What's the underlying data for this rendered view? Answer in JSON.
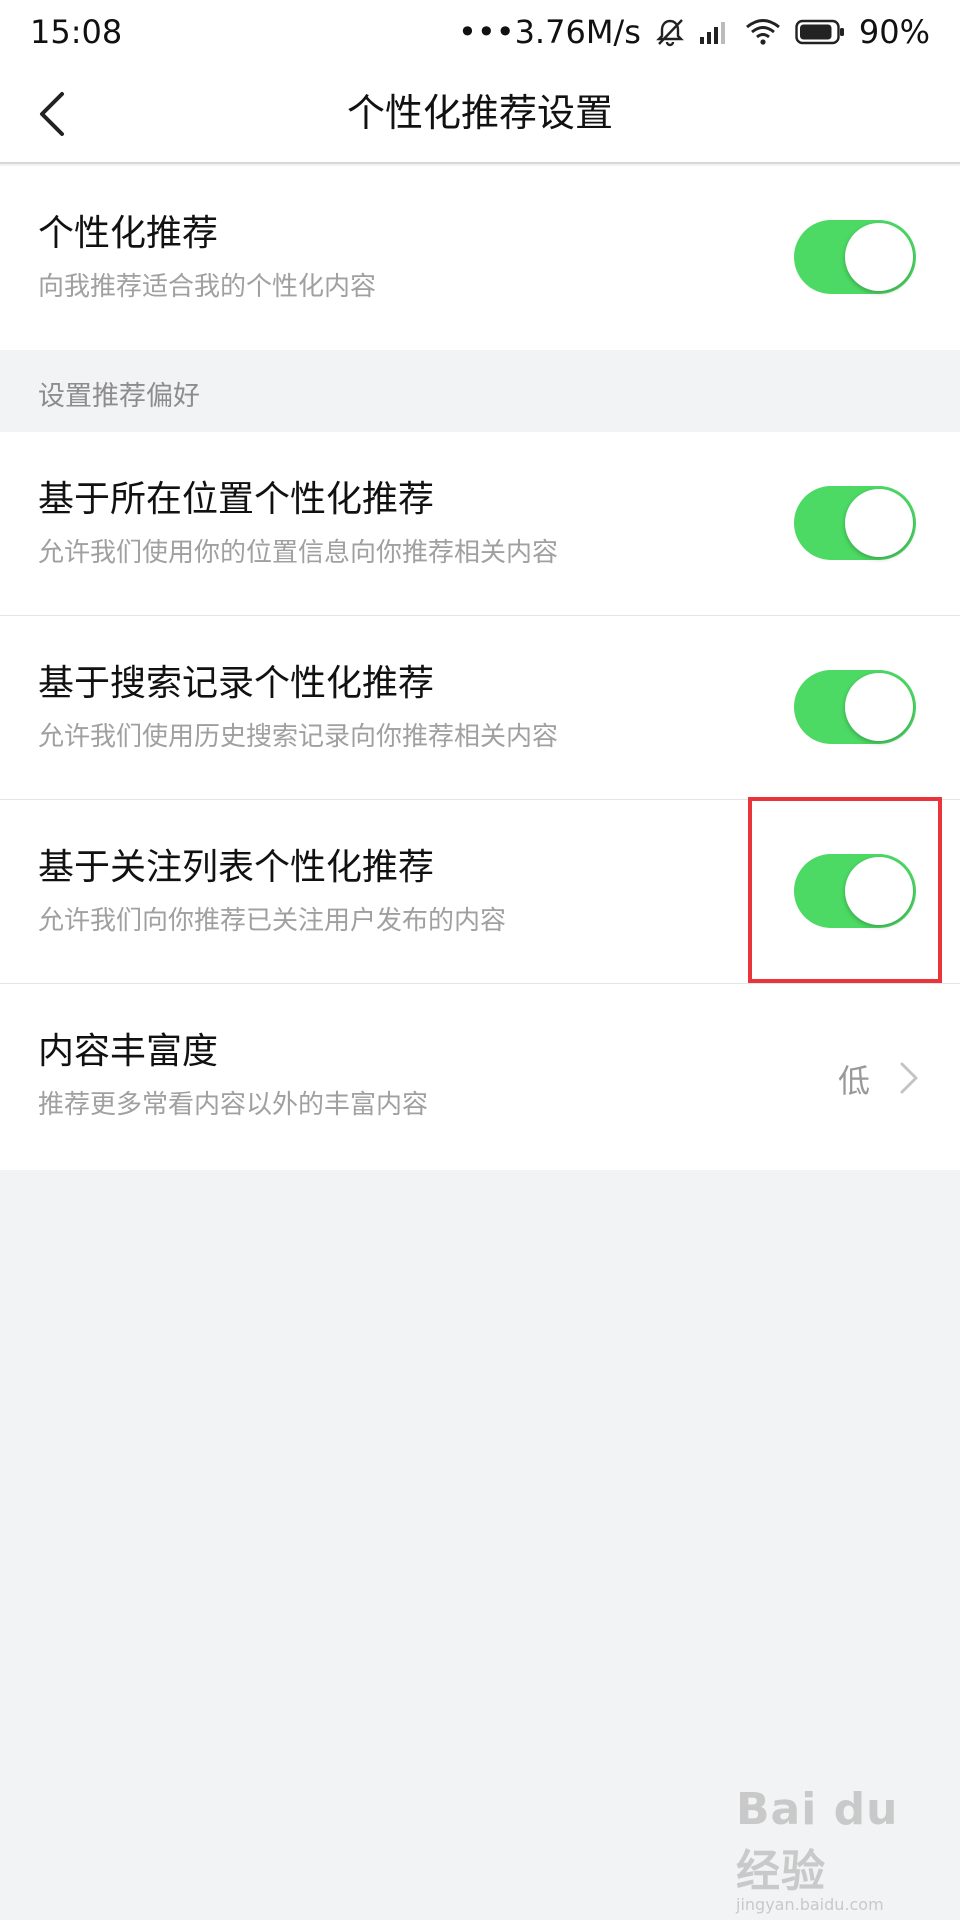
{
  "status_bar": {
    "time": "15:08",
    "network_speed": "•••3.76M/s",
    "battery_percent": "90%",
    "battery_level": 0.9,
    "icons": [
      "mute-bell-icon",
      "signal-icon",
      "wifi-icon",
      "battery-icon"
    ]
  },
  "nav": {
    "title": "个性化推荐设置",
    "back_icon": "chevron-left-icon"
  },
  "main_setting": {
    "title": "个性化推荐",
    "description": "向我推荐适合我的个性化内容",
    "enabled": true
  },
  "preferences_header": "设置推荐偏好",
  "preferences": [
    {
      "title": "基于所在位置个性化推荐",
      "description": "允许我们使用你的位置信息向你推荐相关内容",
      "enabled": true
    },
    {
      "title": "基于搜索记录个性化推荐",
      "description": "允许我们使用历史搜索记录向你推荐相关内容",
      "enabled": true
    },
    {
      "title": "基于关注列表个性化推荐",
      "description": "允许我们向你推荐已关注用户发布的内容",
      "enabled": true
    }
  ],
  "richness": {
    "title": "内容丰富度",
    "description": "推荐更多常看内容以外的丰富内容",
    "value": "低"
  },
  "watermark": {
    "logo": "Bai du 经验",
    "url": "jingyan.baidu.com"
  },
  "colors": {
    "toggle_on": "#4cd964",
    "highlight": "#e8343a",
    "background": "#f2f3f5"
  }
}
